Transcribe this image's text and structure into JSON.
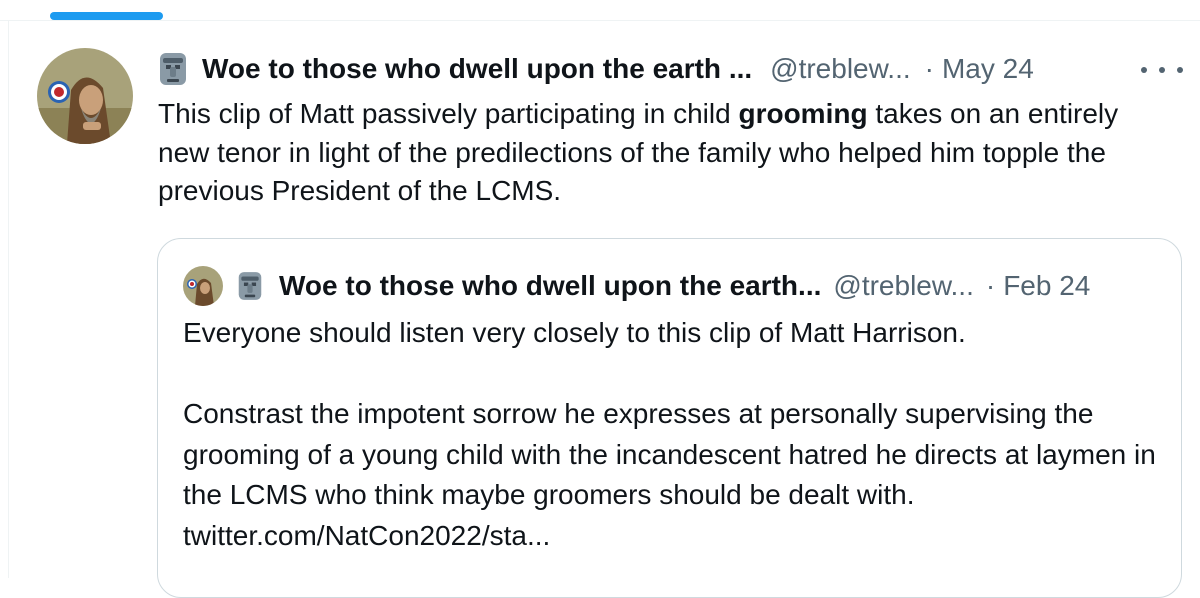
{
  "tweet": {
    "author": {
      "display_name": "Woe to those who dwell upon the earth ...",
      "handle": "@treblew...",
      "avatar_icon": "monk-portrait-avatar",
      "badge_icon": "moai-emoji"
    },
    "separator": "·",
    "date": "May 24",
    "more_label": "More",
    "text": {
      "before_bold": "This clip of Matt passively participating in child ",
      "bold": "grooming",
      "after_bold": " takes on an entirely new tenor in light of the predilections of the family who helped him topple the previous President of the LCMS."
    }
  },
  "quote": {
    "author": {
      "display_name": "Woe to those who dwell upon the earth...",
      "handle": "@treblew...",
      "avatar_icon": "monk-portrait-avatar",
      "badge_icon": "moai-emoji"
    },
    "separator": "·",
    "date": "Feb 24",
    "paragraph1": "Everyone should listen very closely to this clip of Matt Harrison.",
    "paragraph2": "Constrast the impotent sorrow he expresses at personally supervising the grooming of a young child with the incandescent hatred he directs at laymen in the LCMS who think maybe groomers should be dealt with. ",
    "link": "twitter.com/NatCon2022/sta..."
  },
  "colors": {
    "accent": "#1d9bf0",
    "text_primary": "#0f1419",
    "text_secondary": "#536471",
    "border": "#cfd9de"
  }
}
